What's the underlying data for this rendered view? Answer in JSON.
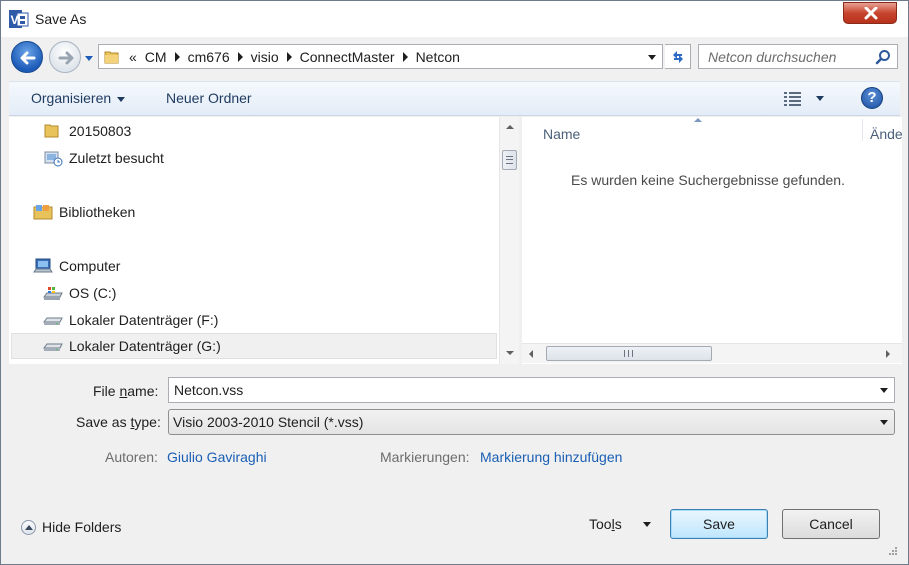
{
  "window": {
    "title": "Save As",
    "app_icon": "visio-icon",
    "close_icon": "close-icon"
  },
  "address": {
    "overflow": "«",
    "crumbs": [
      "CM",
      "cm676",
      "visio",
      "ConnectMaster",
      "Netcon"
    ]
  },
  "search": {
    "placeholder": "Netcon durchsuchen"
  },
  "toolbar": {
    "organise_label": "Organisieren",
    "new_folder_label": "Neuer Ordner",
    "help_label": "?"
  },
  "nav": {
    "items": [
      {
        "label": "20150803",
        "icon": "folder-icon"
      },
      {
        "label": "Zuletzt besucht",
        "icon": "recent-places-icon"
      },
      {
        "label": "Bibliotheken",
        "icon": "libraries-icon"
      },
      {
        "label": "Computer",
        "icon": "computer-icon"
      },
      {
        "label": "OS (C:)",
        "icon": "windows-drive-icon"
      },
      {
        "label": "Lokaler Datenträger (F:)",
        "icon": "drive-icon"
      },
      {
        "label": "Lokaler Datenträger (G:)",
        "icon": "drive-icon"
      }
    ]
  },
  "filelist": {
    "col_name": "Name",
    "col_changed": "Ände",
    "empty_message": "Es wurden keine Suchergebnisse gefunden."
  },
  "form": {
    "filename_label_pre": "File ",
    "filename_label_key": "n",
    "filename_label_post": "ame:",
    "filename_value": "Netcon.vss",
    "savetype_label_pre": "Save as ",
    "savetype_label_key": "t",
    "savetype_label_post": "ype:",
    "savetype_value": "Visio 2003-2010 Stencil (*.vss)",
    "authors_label": "Autoren:",
    "authors_value": "Giulio Gaviraghi",
    "tags_label": "Markierungen:",
    "tags_value": "Markierung hinzufügen"
  },
  "footer": {
    "hide_folders_label": "Hide Folders",
    "tools_label_pre": "Too",
    "tools_label_key": "l",
    "tools_label_post": "s",
    "save_label": "Save",
    "cancel_label": "Cancel"
  },
  "colors": {
    "accent": "#1a5fb4",
    "close": "#c7452f"
  }
}
